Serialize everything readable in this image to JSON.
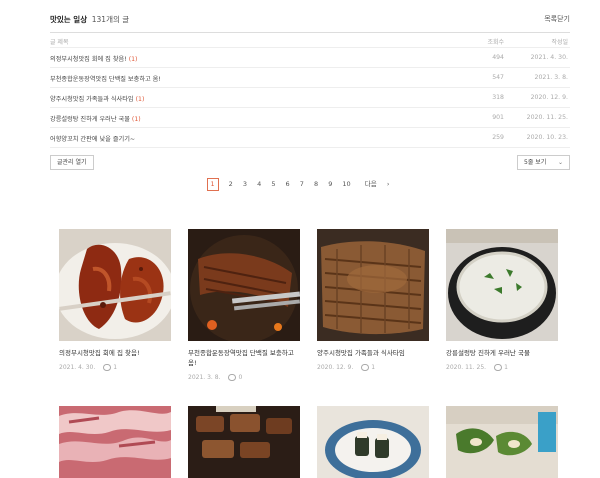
{
  "header": {
    "title": "맛있는 일상",
    "count": "131개의 글",
    "close": "목록닫기"
  },
  "columns": {
    "title": "글 제목",
    "views": "조회수",
    "date": "작성일"
  },
  "rows": [
    {
      "title": "의정부시청맛집 회에 집 찾음!",
      "comments": "(1)",
      "views": "494",
      "date": "2021. 4. 30."
    },
    {
      "title": "부천종합운동장역맛집 단백질 보충하고 옴!",
      "comments": "",
      "views": "547",
      "date": "2021. 3. 8."
    },
    {
      "title": "양주시청맛집 가족들과 식사타임",
      "comments": "(1)",
      "views": "318",
      "date": "2020. 12. 9."
    },
    {
      "title": "강릉설렁탕 진하게 우러난 국물",
      "comments": "(1)",
      "views": "901",
      "date": "2020. 11. 25."
    },
    {
      "title": "어향양꼬치 간판에 낮을 즐기기~",
      "comments": "",
      "views": "259",
      "date": "2020. 10. 23."
    }
  ],
  "buttons": {
    "manage": "글관리 열기",
    "per_page": "5줄 보기"
  },
  "pager": {
    "pages": [
      "1",
      "2",
      "3",
      "4",
      "5",
      "6",
      "7",
      "8",
      "9",
      "10"
    ],
    "current": "1",
    "next": "다음"
  },
  "cards": [
    {
      "title": "의정부시청맛집 회에 집 찾음!",
      "date": "2021. 4. 30.",
      "comments": "1",
      "image": "spicy-grilled-pork"
    },
    {
      "title": "부천종합운동장역맛집 단백질 보충하고 옴!",
      "date": "2021. 3. 8.",
      "comments": "0",
      "image": "grilled-ribs-tongs"
    },
    {
      "title": "양주시청맛집 가족들과 식사타임",
      "date": "2020. 12. 9.",
      "comments": "1",
      "image": "grilled-meat-grill"
    },
    {
      "title": "강릉설렁탕 진하게 우러난 국물",
      "date": "2020. 11. 25.",
      "comments": "1",
      "image": "beef-bone-soup"
    },
    {
      "title": "",
      "date": "",
      "comments": "",
      "image": "raw-lamb-slices"
    },
    {
      "title": "",
      "date": "",
      "comments": "",
      "image": "grilled-pork-belly"
    },
    {
      "title": "",
      "date": "",
      "comments": "",
      "image": "sushi-plate"
    },
    {
      "title": "",
      "date": "",
      "comments": "",
      "image": "kimbap-rolls"
    }
  ],
  "colors": {
    "accent": "#e05a3a",
    "border": "#dddddd"
  }
}
